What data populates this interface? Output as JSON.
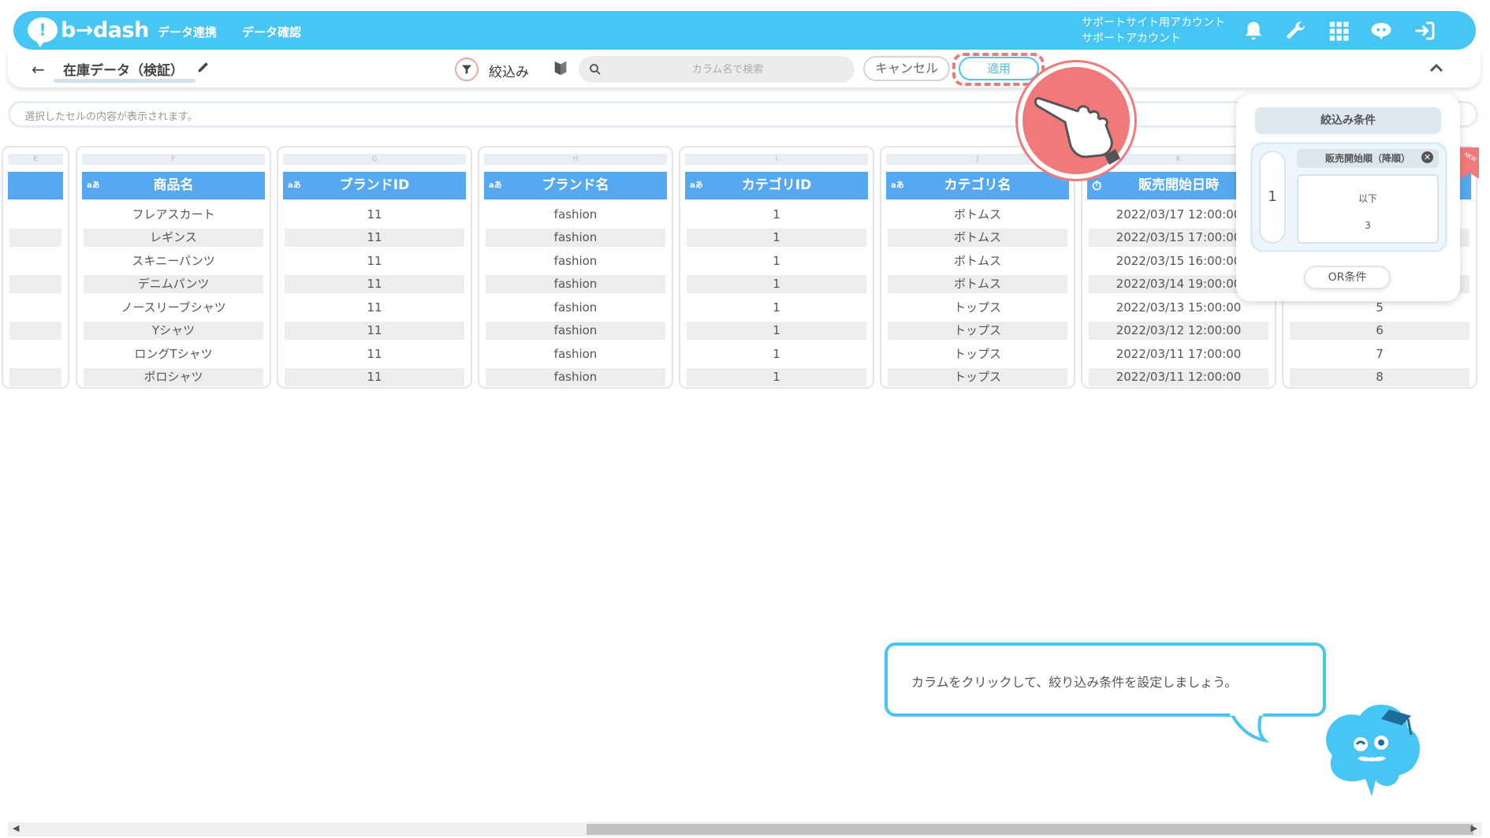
{
  "header": {
    "logo_text": "b→dash",
    "nav": [
      "データ連携",
      "データ確認"
    ],
    "account_line1": "サポートサイト用アカウント",
    "account_line2": "サポートアカウント"
  },
  "toolbar": {
    "table_name": "在庫データ（検証）",
    "filter_label": "絞込み",
    "search_placeholder": "カラム名で検索",
    "cancel_label": "キャンセル",
    "apply_label": "適用"
  },
  "cellbar": {
    "placeholder": "選択したセルの内容が表示されます。"
  },
  "columns": [
    {
      "letter": "E",
      "type": "",
      "name": "",
      "cells": [
        "",
        "",
        "",
        "",
        "",
        "",
        "",
        ""
      ]
    },
    {
      "letter": "F",
      "type": "aあ",
      "name": "商品名",
      "cells": [
        "フレアスカート",
        "レギンス",
        "スキニーパンツ",
        "デニムパンツ",
        "ノースリーブシャツ",
        "Yシャツ",
        "ロングTシャツ",
        "ポロシャツ"
      ]
    },
    {
      "letter": "G",
      "type": "aあ",
      "name": "ブランドID",
      "cells": [
        "11",
        "11",
        "11",
        "11",
        "11",
        "11",
        "11",
        "11"
      ]
    },
    {
      "letter": "H",
      "type": "aあ",
      "name": "ブランド名",
      "cells": [
        "fashion",
        "fashion",
        "fashion",
        "fashion",
        "fashion",
        "fashion",
        "fashion",
        "fashion"
      ]
    },
    {
      "letter": "I",
      "type": "aあ",
      "name": "カテゴリID",
      "cells": [
        "1",
        "1",
        "1",
        "1",
        "1",
        "1",
        "1",
        "1"
      ]
    },
    {
      "letter": "J",
      "type": "aあ",
      "name": "カテゴリ名",
      "cells": [
        "ボトムス",
        "ボトムス",
        "ボトムス",
        "ボトムス",
        "トップス",
        "トップス",
        "トップス",
        "トップス"
      ]
    },
    {
      "letter": "K",
      "type": "⏱",
      "name": "販売開始日時",
      "cells": [
        "2022/03/17 12:00:00",
        "2022/03/15 17:00:00",
        "2022/03/15 16:00:00",
        "2022/03/14 19:00:00",
        "2022/03/13 15:00:00",
        "2022/03/12 12:00:00",
        "2022/03/11 17:00:00",
        "2022/03/11 12:00:00"
      ]
    },
    {
      "letter": "",
      "type": "",
      "name": "",
      "cells": [
        "",
        "",
        "",
        "",
        "5",
        "6",
        "7",
        "8"
      ]
    }
  ],
  "filter_panel": {
    "title": "絞込み条件",
    "group_number": "1",
    "column_tag": "販売開始順（降順）",
    "operator": "以下",
    "value": "3",
    "or_button": "OR条件"
  },
  "new_badge": "NEW",
  "tooltip": {
    "text": "カラムをクリックして、絞り込み条件を設定しましょう。"
  },
  "colors": {
    "brand": "#47c5f4",
    "header_col": "#56a9f0",
    "accent_red": "#f07a7a"
  }
}
